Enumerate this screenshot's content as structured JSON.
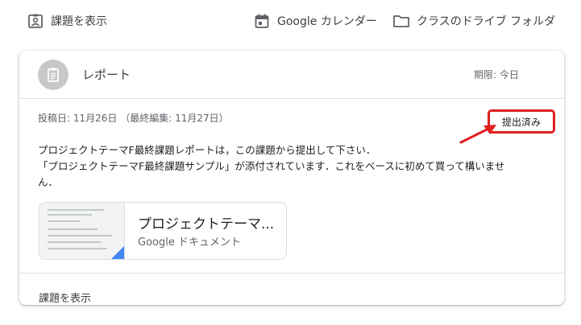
{
  "toolbar": {
    "view_assignment_label": "課題を表示",
    "calendar_label": "Google カレンダー",
    "drive_folder_label": "クラスのドライブ フォルダ"
  },
  "assignment": {
    "title": "レポート",
    "due": "期限: 今日",
    "meta": "投稿日: 11月26日 （最終編集: 11月27日）",
    "status": "提出済み",
    "description_lines": [
      "プロジェクトテーマF最終課題レポートは，この課題から提出して下さい．",
      "「プロジェクトテーマF最終課題サンプル」が添付されています．これをベースに初めて買って構いませ",
      "ん．"
    ],
    "attachment": {
      "title": "プロジェクトテーマ...",
      "type": "Google ドキュメント"
    },
    "footer_link": "課題を表示"
  },
  "colors": {
    "highlight_red": "#e02020",
    "docs_blue": "#4285f4",
    "avatar_gray": "#c8c8c8"
  }
}
